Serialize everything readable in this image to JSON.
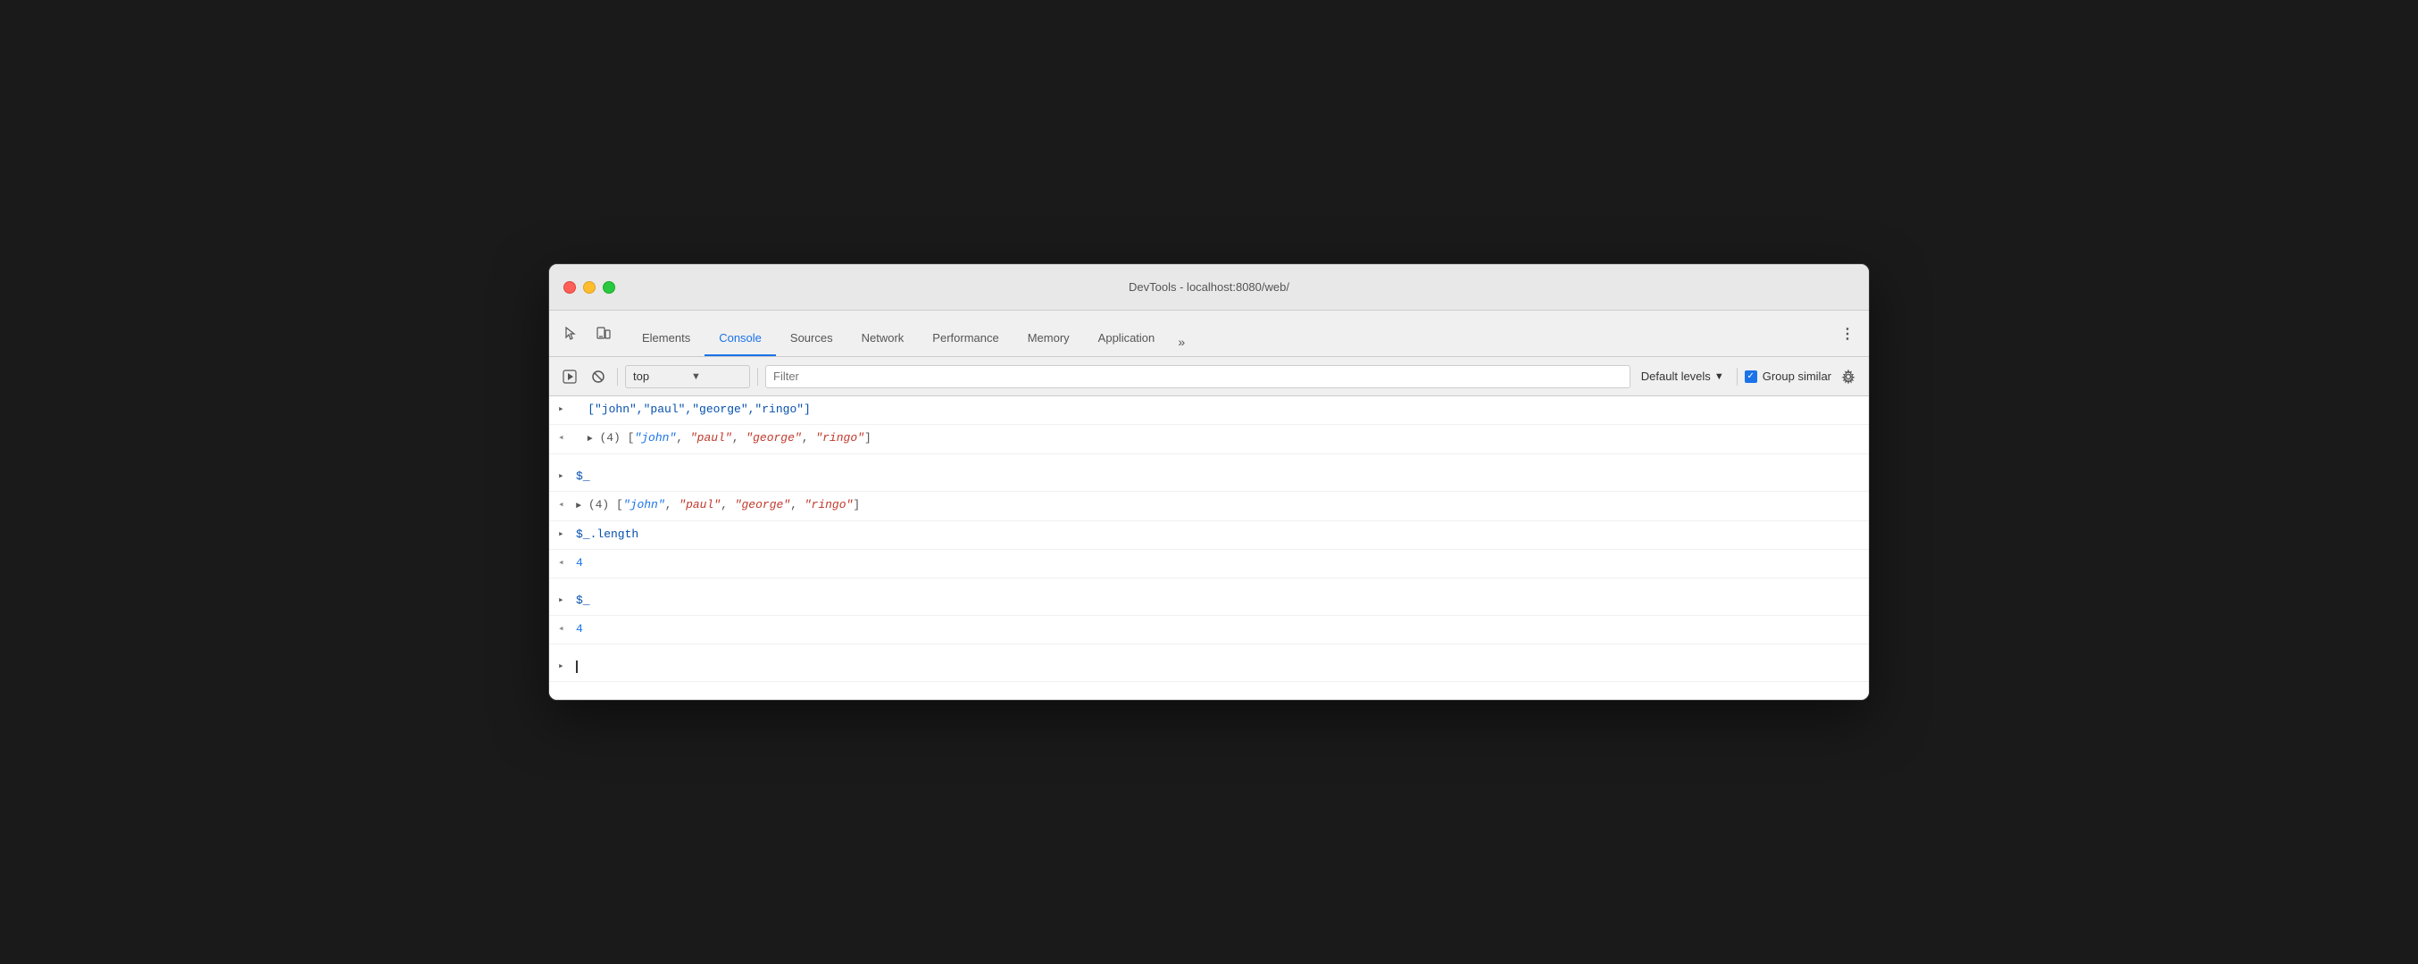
{
  "window": {
    "title": "DevTools - localhost:8080/web/"
  },
  "tabs": [
    {
      "id": "elements",
      "label": "Elements",
      "active": false
    },
    {
      "id": "console",
      "label": "Console",
      "active": true
    },
    {
      "id": "sources",
      "label": "Sources",
      "active": false
    },
    {
      "id": "network",
      "label": "Network",
      "active": false
    },
    {
      "id": "performance",
      "label": "Performance",
      "active": false
    },
    {
      "id": "memory",
      "label": "Memory",
      "active": false
    },
    {
      "id": "application",
      "label": "Application",
      "active": false
    }
  ],
  "console_toolbar": {
    "top_label": "top",
    "filter_placeholder": "Filter",
    "default_levels": "Default levels",
    "group_similar": "Group similar"
  },
  "console_rows": [
    {
      "direction": ">",
      "content_type": "input",
      "text": "[\"john\",\"paul\",\"george\",\"ringo\"]",
      "expandable": false
    },
    {
      "direction": "<",
      "content_type": "output-array",
      "count": 4,
      "items": [
        "\"john\"",
        "\"paul\"",
        "\"george\"",
        "\"ringo\""
      ],
      "expandable": true
    },
    {
      "direction": ">",
      "content_type": "input",
      "text": "$_",
      "expandable": false
    },
    {
      "direction": "<",
      "content_type": "output-array",
      "count": 4,
      "items": [
        "\"john\"",
        "\"paul\"",
        "\"george\"",
        "\"ringo\""
      ],
      "expandable": true
    },
    {
      "direction": ">",
      "content_type": "input",
      "text": "$_.length",
      "expandable": false
    },
    {
      "direction": "<",
      "content_type": "number",
      "text": "4",
      "expandable": false
    },
    {
      "direction": ">",
      "content_type": "input",
      "text": "$_",
      "expandable": false
    },
    {
      "direction": "<",
      "content_type": "number",
      "text": "4",
      "expandable": false
    },
    {
      "direction": ">",
      "content_type": "cursor",
      "text": "",
      "expandable": false
    }
  ]
}
